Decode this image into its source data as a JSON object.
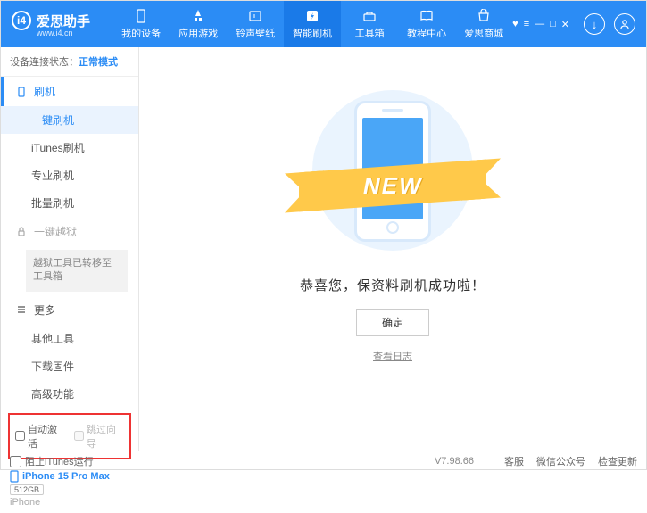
{
  "header": {
    "app_name": "爱思助手",
    "url": "www.i4.cn",
    "nav": [
      {
        "label": "我的设备"
      },
      {
        "label": "应用游戏"
      },
      {
        "label": "铃声壁纸"
      },
      {
        "label": "智能刷机"
      },
      {
        "label": "工具箱"
      },
      {
        "label": "教程中心"
      },
      {
        "label": "爱思商城"
      }
    ]
  },
  "sidebar": {
    "status_label": "设备连接状态：",
    "status_value": "正常模式",
    "flash_header": "刷机",
    "flash_items": [
      "一键刷机",
      "iTunes刷机",
      "专业刷机",
      "批量刷机"
    ],
    "jailbreak_header": "一键越狱",
    "jailbreak_box": "越狱工具已转移至工具箱",
    "more_header": "更多",
    "more_items": [
      "其他工具",
      "下载固件",
      "高级功能"
    ],
    "cb1": "自动激活",
    "cb2": "跳过向导",
    "device": {
      "name": "iPhone 15 Pro Max",
      "capacity": "512GB",
      "type": "iPhone"
    }
  },
  "main": {
    "ribbon": "NEW",
    "message": "恭喜您，保资料刷机成功啦！",
    "ok": "确定",
    "log": "查看日志"
  },
  "footer": {
    "block_itunes": "阻止iTunes运行",
    "version": "V7.98.66",
    "links": [
      "客服",
      "微信公众号",
      "检查更新"
    ]
  }
}
